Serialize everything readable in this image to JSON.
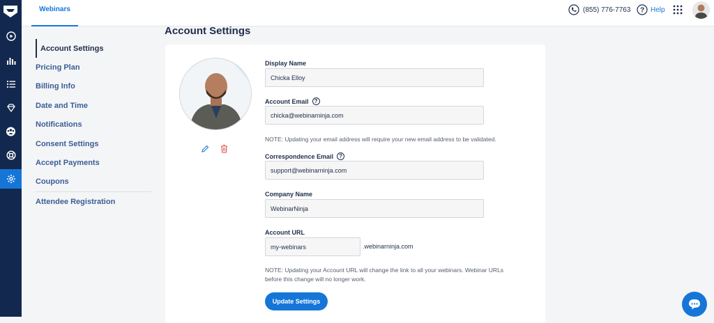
{
  "app": {
    "tab_label": "Webinars",
    "phone": "(855) 776-7763",
    "help_label": "Help"
  },
  "rail": {
    "icons": [
      "logo-icon",
      "play-icon",
      "analytics-icon",
      "list-icon",
      "diamond-icon",
      "people-icon",
      "support-icon",
      "settings-icon"
    ],
    "active": "settings-icon"
  },
  "page": {
    "title": "Account Settings"
  },
  "menu": {
    "items": [
      {
        "label": "Account Settings"
      },
      {
        "label": "Pricing Plan"
      },
      {
        "label": "Billing Info"
      },
      {
        "label": "Date and Time"
      },
      {
        "label": "Notifications"
      },
      {
        "label": "Consent Settings"
      },
      {
        "label": "Accept Payments"
      },
      {
        "label": "Coupons"
      },
      {
        "label": "Attendee Registration"
      }
    ]
  },
  "form": {
    "display_name": {
      "label": "Display Name",
      "value": "Chicka Elloy"
    },
    "account_email": {
      "label": "Account Email",
      "value": "chicka@webinarninja.com",
      "note": "NOTE: Updating your email address will require your new email address to be validated."
    },
    "correspondence_email": {
      "label": "Correspondence Email",
      "value": "support@webinarninja.com"
    },
    "company_name": {
      "label": "Company Name",
      "value": "WebinarNinja"
    },
    "account_url": {
      "label": "Account URL",
      "value": "my-webinars",
      "suffix": ".webinarninja.com",
      "note_line1": "NOTE: Updating your Account URL will change the link to all your webinars. Webinar URLs",
      "note_line2": "before this change will no longer work."
    },
    "submit_label": "Update Settings"
  },
  "colors": {
    "accent": "#1576d8",
    "rail": "#13284f",
    "danger": "#e04b4b"
  }
}
